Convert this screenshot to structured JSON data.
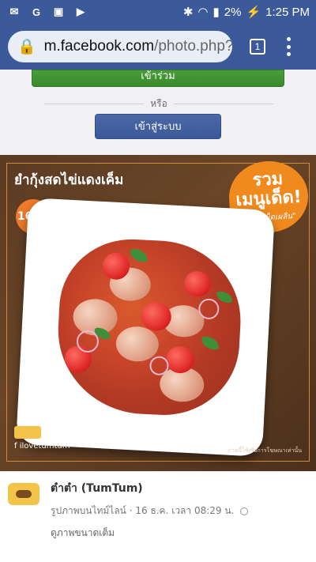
{
  "status_bar": {
    "left_icons": [
      "gmail-icon",
      "google-icon",
      "gallery-icon",
      "youtube-icon"
    ],
    "battery": "2%",
    "time": "1:25 PM"
  },
  "browser": {
    "url_host": "m.facebook.com",
    "url_path": "/photo.php?",
    "tab_count": "1"
  },
  "auth": {
    "join_label": "เข้าร่วม",
    "or_label": "หรือ",
    "login_label": "เข้าสู่ระบบ"
  },
  "photo": {
    "title": "ยำกุ้งสดไข่แดงเค็ม",
    "price": "169.-",
    "promo_title": "รวม\nเมนูเด็ด!",
    "promo_subtitle": "\"แซ่บเผ็ดเผลิน\"",
    "brand_handle": "ilovetumtum",
    "fine_print": "ภาพนี้ใช้เพื่อการโฆษณาเท่านั้น"
  },
  "post": {
    "page_name": "ตำตำ (TumTum)",
    "meta": "รูปภาพบนไทม์ไลน์ · 16 ธ.ค. เวลา 08:29 น.",
    "view_full": "ดูภาพขนาดเต็ม"
  },
  "colors": {
    "fb_blue": "#3c5a99",
    "join_green": "#3a8a2c",
    "promo_orange": "#f08a1e"
  }
}
